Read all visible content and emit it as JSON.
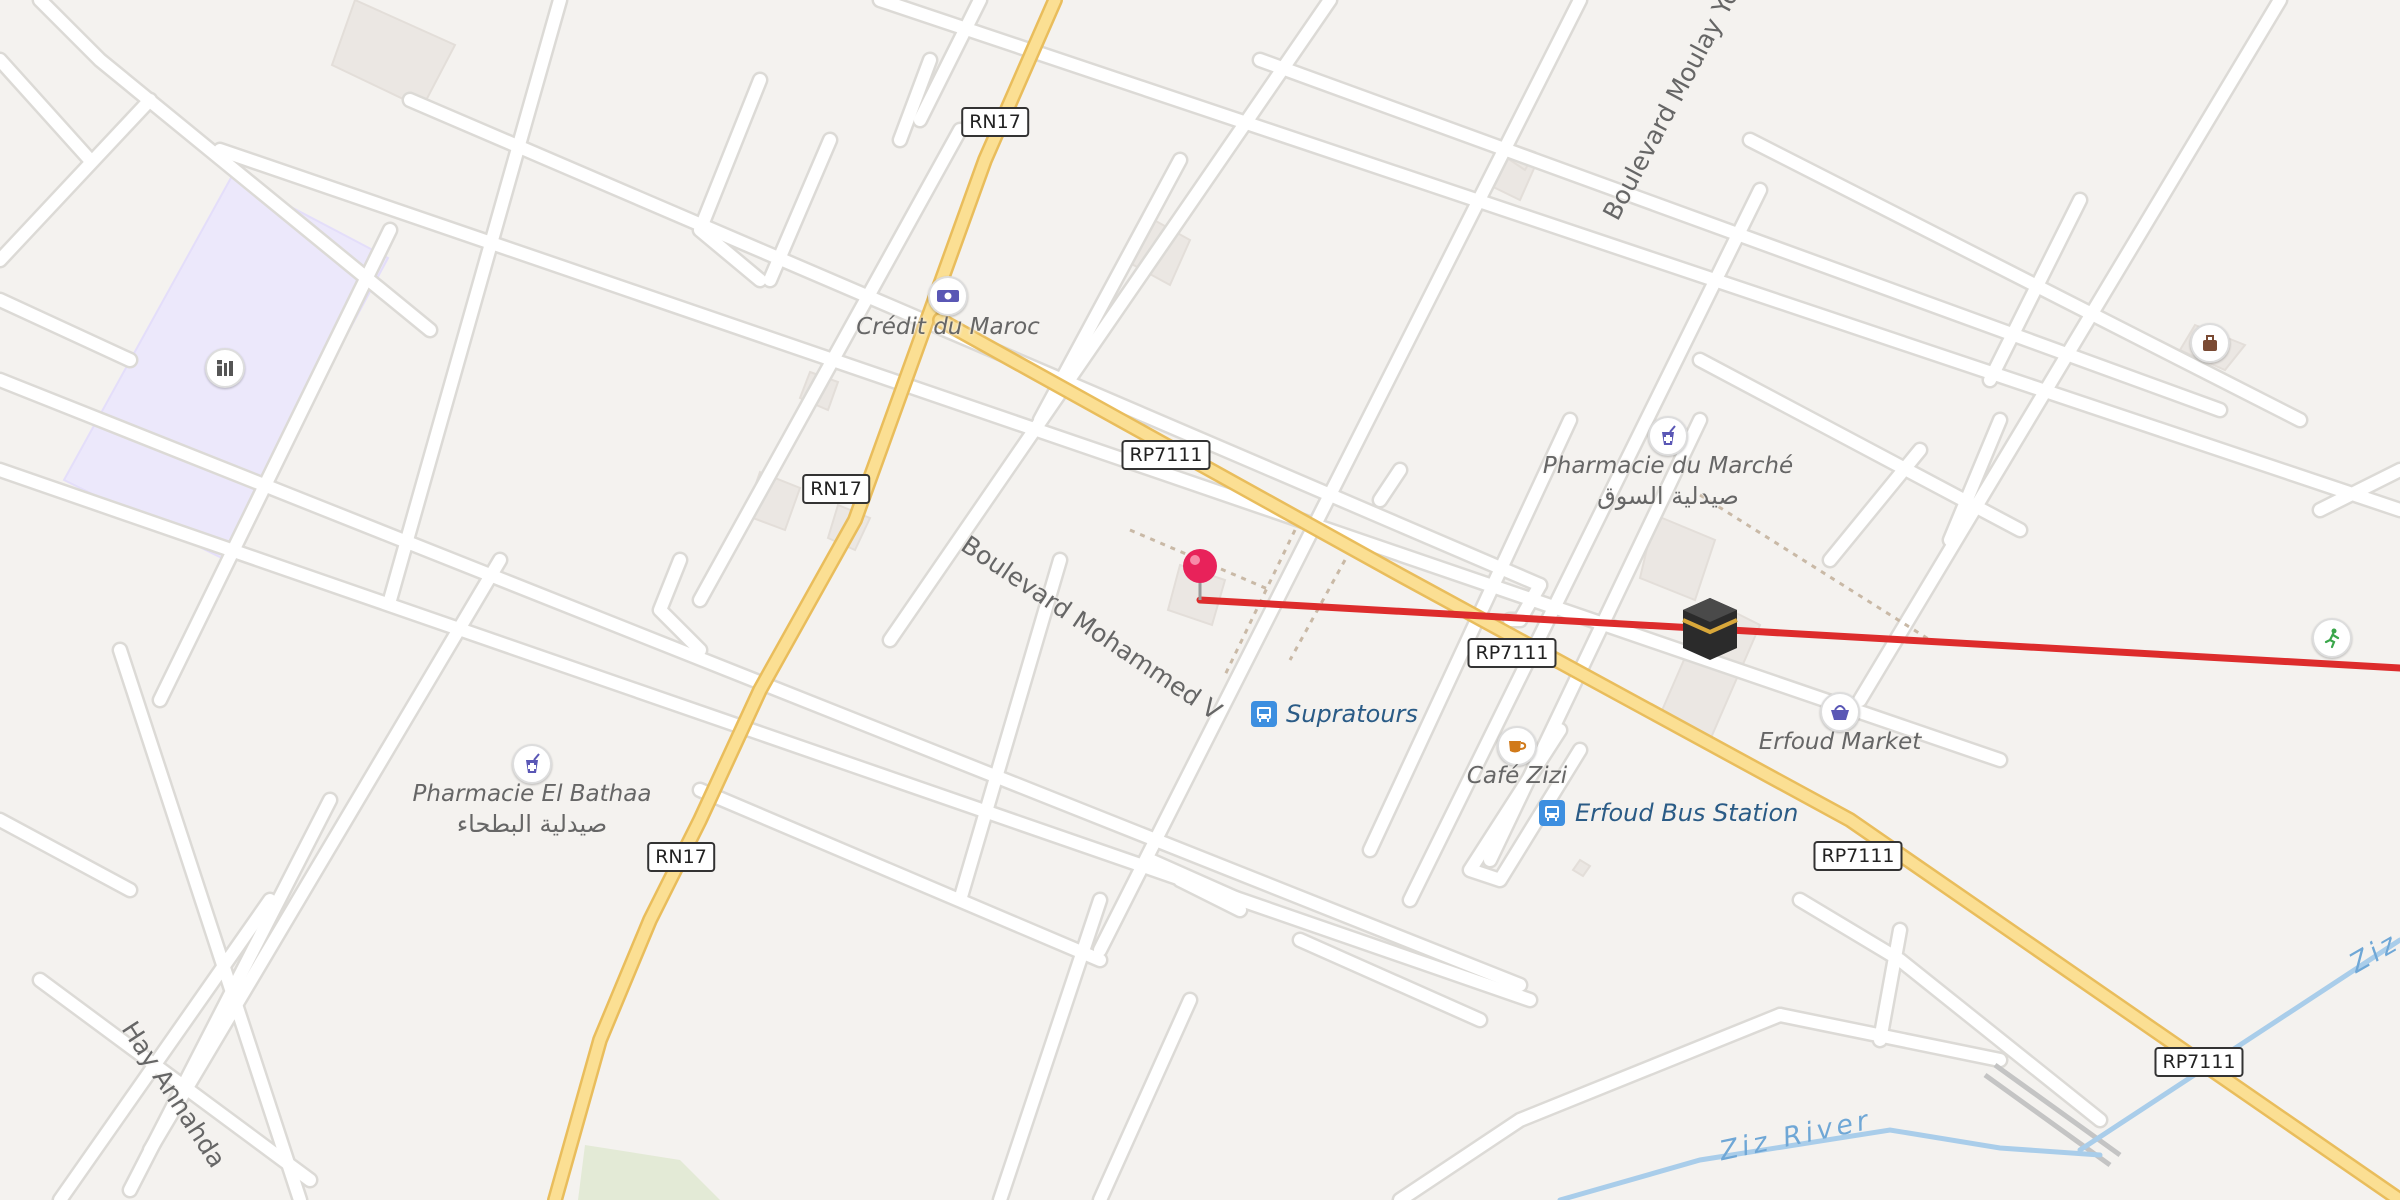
{
  "map": {
    "streets": {
      "boulevard_mohammed_v": "Boulevard Mohammed V",
      "boulevard_moulay": "Boulevard Moulay Yo",
      "hay_annahda": "Hay Annahda"
    },
    "road_shields": [
      "RN17",
      "RN17",
      "RN17",
      "RP7111",
      "RP7111",
      "RP7111",
      "RP7111"
    ],
    "waterways": {
      "ziz_river": "Ziz River",
      "ziz_partial": "Ziz"
    },
    "pois": {
      "credit_du_maroc": "Crédit du Maroc",
      "pharmacie_du_marche": "Pharmacie du Marché",
      "pharmacie_du_marche_ar": "صيدلية السوق",
      "pharmacie_el_bathaa": "Pharmacie El Bathaa",
      "pharmacie_el_bathaa_ar": "صيدلية البطحاء",
      "supratours": "Supratours",
      "cafe_zizi": "Café Zizi",
      "erfoud_bus_station": "Erfoud Bus Station",
      "erfoud_market": "Erfoud Market"
    },
    "icons": {
      "bank": "bank-icon",
      "pharmacy": "pharmacy-icon",
      "bus": "bus-stop-icon",
      "cafe": "cafe-icon",
      "market": "shopping-basket-icon",
      "school": "school-icon",
      "lodging": "lodging-icon",
      "sport": "sport-icon",
      "qibla": "kaaba-icon",
      "pin": "location-pin-icon"
    },
    "colors": {
      "background": "#f4f2ef",
      "road": "#ffffff",
      "road_casing": "#dcdad6",
      "primary_road": "#fbdf93",
      "primary_casing": "#e9bd5c",
      "route_line": "#dd2c2c",
      "water": "#a9cdea",
      "school_area": "#ece8fb",
      "pin": "#e8225a"
    }
  }
}
